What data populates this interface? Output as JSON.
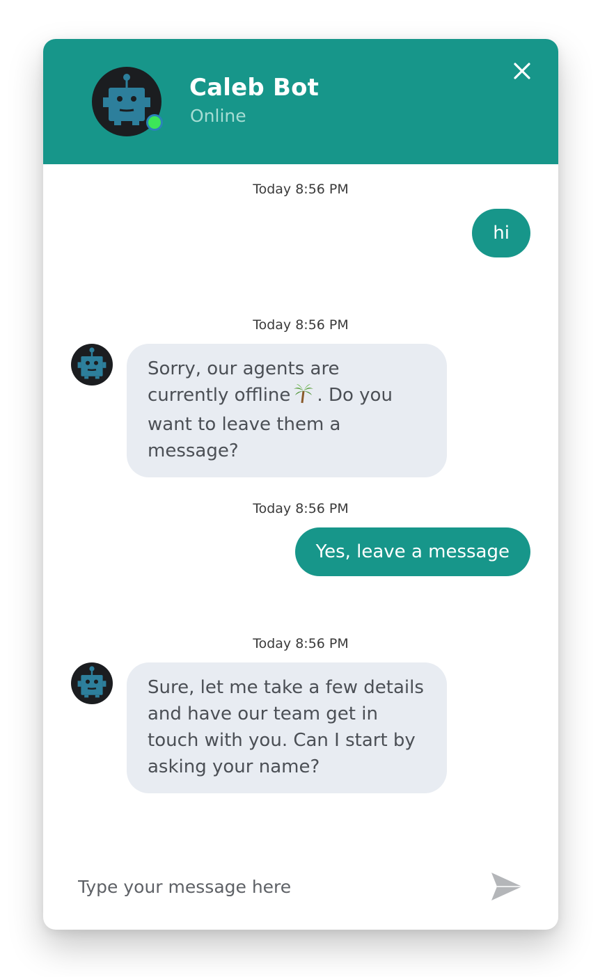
{
  "header": {
    "bot_name": "Caleb Bot",
    "status": "Online",
    "colors": {
      "header_bg": "#17968a",
      "status_text": "#a6ddd4",
      "online_dot": "#3ce659"
    }
  },
  "messages": [
    {
      "timestamp": "Today 8:56 PM",
      "sender": "user",
      "text": "hi"
    },
    {
      "timestamp": "Today 8:56 PM",
      "sender": "bot",
      "text_before_emoji": "Sorry, our agents are currently offline",
      "emoji_icon": "palm-tree-icon",
      "text_after_emoji": ". Do you want to leave them a message?"
    },
    {
      "timestamp": "Today 8:56 PM",
      "sender": "user",
      "text": "Yes, leave a message"
    },
    {
      "timestamp": "Today 8:56 PM",
      "sender": "bot",
      "text": "Sure, let me take a few details and have our team get in touch with you. Can I start by asking your name?"
    }
  ],
  "composer": {
    "placeholder": "Type your message here",
    "value": ""
  },
  "icons": {
    "close": "close-icon",
    "send": "send-icon",
    "avatar": "robot-icon"
  },
  "colors": {
    "user_bubble": "#17968a",
    "bot_bubble": "#e8ecf2"
  }
}
